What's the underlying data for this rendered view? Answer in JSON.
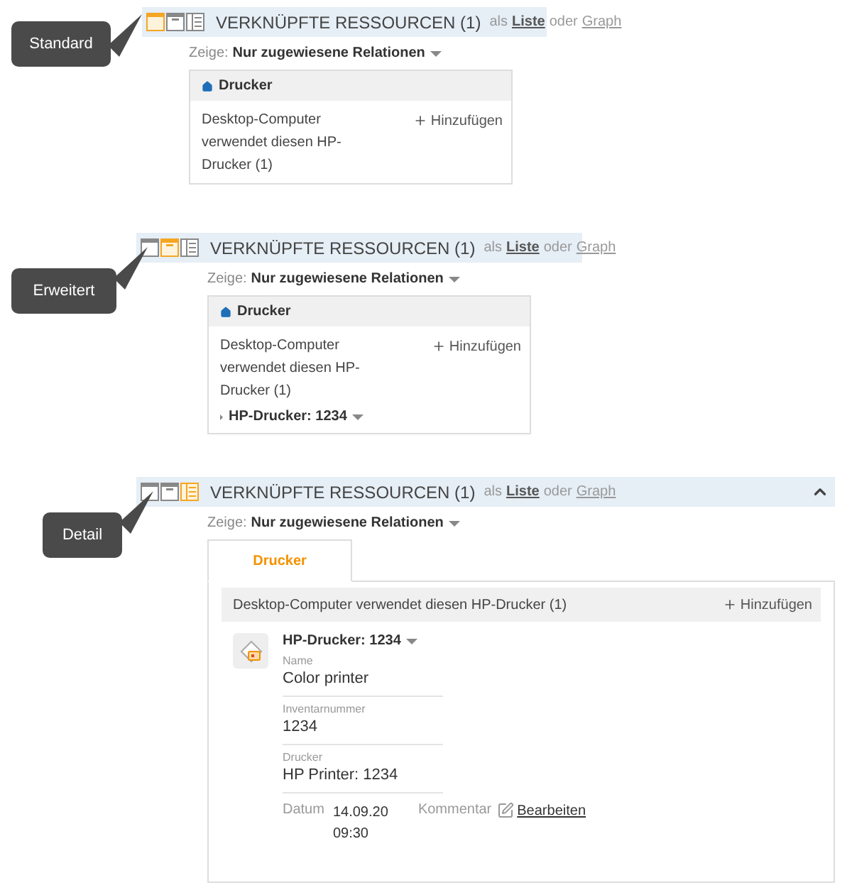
{
  "sections": [
    {
      "kind": "standard",
      "callout": "Standard",
      "view_modes": [
        {
          "kind": "standard",
          "selected": true
        },
        {
          "kind": "extended",
          "selected": false
        },
        {
          "kind": "detail",
          "selected": false
        }
      ],
      "title": "VERKNÜPFTE RESSOURCEN (1)",
      "as_prefix": "als",
      "list_link": "Liste",
      "or_text": "oder",
      "graph_link": "Graph",
      "filter": {
        "label": "Zeige:",
        "value": "Nur zugewiesene Relationen"
      },
      "group": {
        "title": "Drucker",
        "relation": "Desktop-Computer verwendet diesen HP-Drucker (1)",
        "add": "Hinzufügen"
      }
    },
    {
      "kind": "extended",
      "callout": "Erweitert",
      "view_modes": [
        {
          "kind": "standard",
          "selected": false
        },
        {
          "kind": "extended",
          "selected": true
        },
        {
          "kind": "detail",
          "selected": false
        }
      ],
      "title": "VERKNÜPFTE RESSOURCEN (1)",
      "as_prefix": "als",
      "list_link": "Liste",
      "or_text": "oder",
      "graph_link": "Graph",
      "filter": {
        "label": "Zeige:",
        "value": "Nur zugewiesene Relationen"
      },
      "group": {
        "title": "Drucker",
        "relation": "Desktop-Computer verwendet diesen HP-Drucker (1)",
        "add": "Hinzufügen",
        "item": "HP-Drucker: 1234"
      }
    },
    {
      "kind": "detail",
      "callout": "Detail",
      "view_modes": [
        {
          "kind": "standard",
          "selected": false
        },
        {
          "kind": "extended",
          "selected": false
        },
        {
          "kind": "detail",
          "selected": true
        }
      ],
      "title": "VERKNÜPFTE RESSOURCEN (1)",
      "as_prefix": "als",
      "list_link": "Liste",
      "or_text": "oder",
      "graph_link": "Graph",
      "expanded": true,
      "filter": {
        "label": "Zeige:",
        "value": "Nur zugewiesene Relationen"
      },
      "tabs": [
        {
          "label": "Drucker",
          "selected": true
        }
      ],
      "group": {
        "relation": "Desktop-Computer verwendet diesen HP-Drucker (1)",
        "add": "Hinzufügen",
        "item": "HP-Drucker: 1234",
        "fields": [
          {
            "label": "Name",
            "value": "Color printer"
          },
          {
            "label": "Inventarnummer",
            "value": "1234"
          },
          {
            "label": "Drucker",
            "value": "HP Printer: 1234"
          }
        ],
        "date_label": "Datum",
        "date_value": "14.09.20 09:30",
        "comment_label": "Kommentar",
        "edit_link": "Bearbeiten"
      }
    }
  ]
}
